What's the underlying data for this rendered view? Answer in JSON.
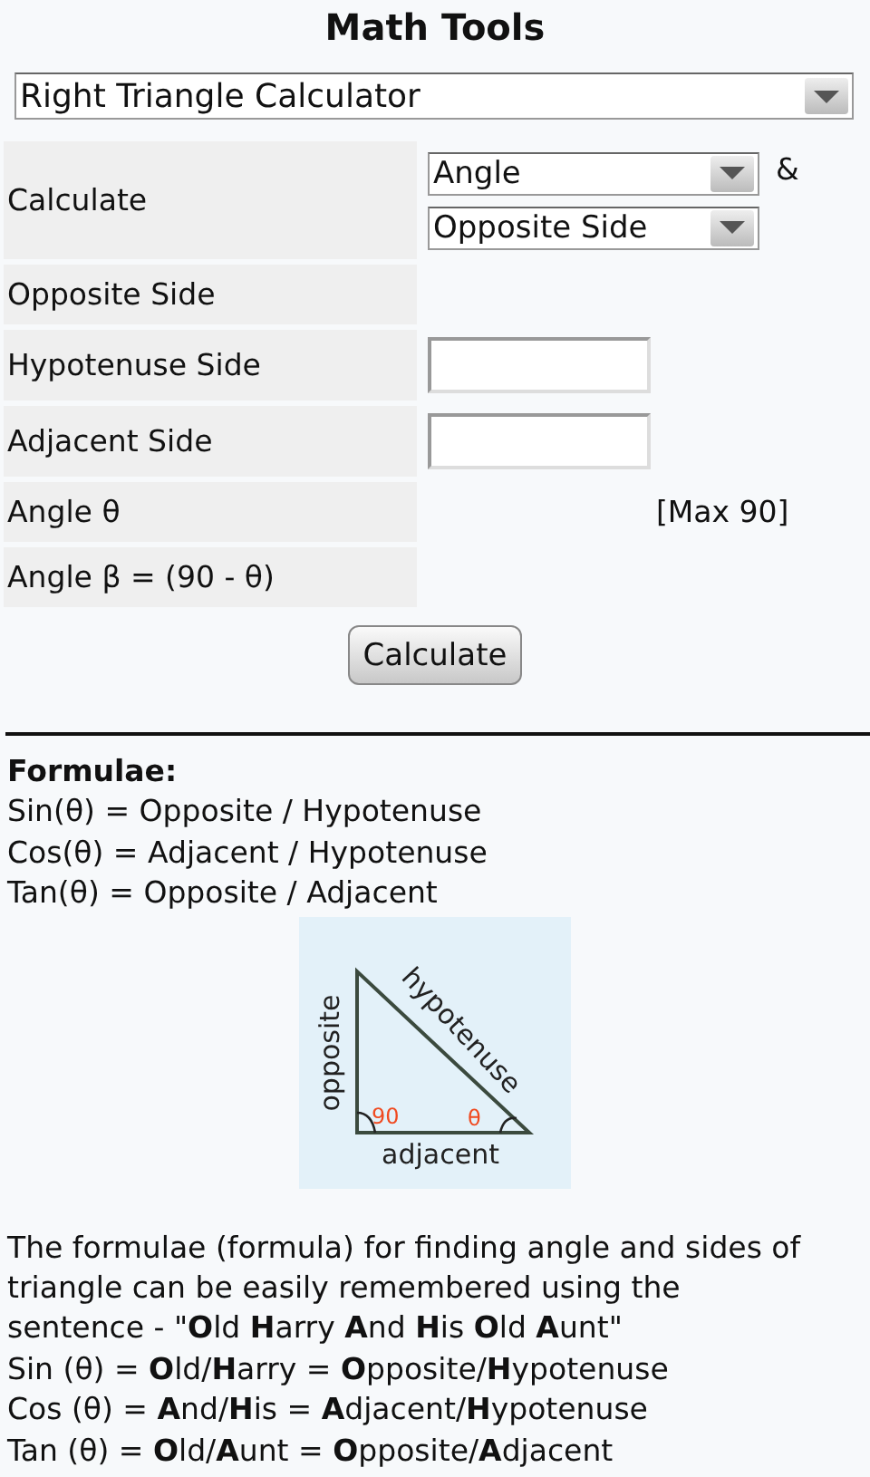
{
  "title": "Math Tools",
  "tool_select": {
    "value": "Right Triangle Calculator"
  },
  "form": {
    "rows": [
      {
        "label": "Calculate",
        "kind": "selects",
        "selects": [
          "Angle",
          "Opposite Side"
        ],
        "joiner": "&"
      },
      {
        "label": "Opposite Side",
        "kind": "empty"
      },
      {
        "label": "Hypotenuse Side",
        "kind": "input"
      },
      {
        "label": "Adjacent Side",
        "kind": "input"
      },
      {
        "label": "Angle θ",
        "kind": "note",
        "note": "[Max 90]"
      },
      {
        "label": "Angle β = (90 - θ)",
        "kind": "empty"
      }
    ],
    "button": "Calculate"
  },
  "formulae": {
    "heading": "Formulae:",
    "lines": [
      "Sin(θ) = Opposite / Hypotenuse",
      "Cos(θ) = Adjacent / Hypotenuse",
      "Tan(θ) = Opposite / Adjacent"
    ]
  },
  "diagram": {
    "opposite": "opposite",
    "hypotenuse": "hypotenuse",
    "adjacent": "adjacent",
    "right_angle": "90",
    "angle": "θ"
  },
  "mnemonic": {
    "paragraph": "The formulae (formula) for finding angle and sides of triangle can be easily remembered using the sentence - \"**O**ld **H**arry **A**nd **H**is **O**ld **A**unt\"",
    "lines": [
      "Sin (θ) = **O**ld/**H**arry = **O**pposite/**H**ypotenuse",
      "Cos (θ) = **A**nd/**H**is = **A**djacent/**H**ypotenuse",
      "Tan (θ) = **O**ld/**A**unt = **O**pposite/**A**djacent"
    ]
  }
}
